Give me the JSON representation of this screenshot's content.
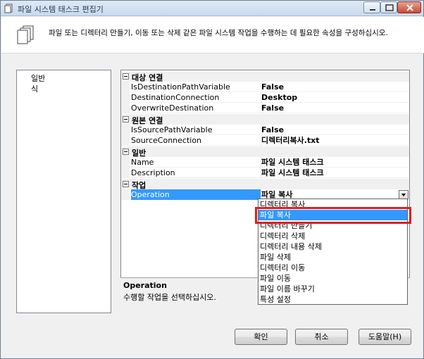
{
  "window": {
    "title": "파일 시스템 태스크 편집기",
    "description": "파일 또는 디렉터리 만들기, 이동 또는 삭제 같은 파일 시스템 작업을 수행하는 데 필요한 속성을 구성하십시오."
  },
  "left_nav": {
    "items": [
      "일반",
      "식"
    ]
  },
  "property_grid": {
    "categories": [
      {
        "label": "대상 연결",
        "props": [
          {
            "name": "IsDestinationPathVariable",
            "value": "False"
          },
          {
            "name": "DestinationConnection",
            "value": "Desktop"
          },
          {
            "name": "OverwriteDestination",
            "value": "False"
          }
        ]
      },
      {
        "label": "원본 연결",
        "props": [
          {
            "name": "IsSourcePathVariable",
            "value": "False"
          },
          {
            "name": "SourceConnection",
            "value": "디렉터리복사.txt"
          }
        ]
      },
      {
        "label": "일반",
        "props": [
          {
            "name": "Name",
            "value": "파일 시스템 태스크"
          },
          {
            "name": "Description",
            "value": "파일 시스템 태스크"
          }
        ]
      },
      {
        "label": "작업",
        "props": [
          {
            "name": "Operation",
            "value": "파일 복사"
          }
        ]
      }
    ]
  },
  "operation_dropdown": {
    "options": [
      "디렉터리 복사",
      "파일 복사",
      "디렉터리 만들기",
      "디렉터리 삭제",
      "디렉터리 내용 삭제",
      "파일 삭제",
      "디렉터리 이동",
      "파일 이동",
      "파일 이름 바꾸기",
      "특성 설정"
    ],
    "selected": "파일 복사"
  },
  "description_panel": {
    "title": "Operation",
    "text": "수행할 작업을 선택하십시오."
  },
  "buttons": {
    "ok": "확인",
    "cancel": "취소",
    "help": "도움말(H)"
  },
  "colors": {
    "selection": "#3399ff",
    "highlight_box": "#e01e1e"
  }
}
